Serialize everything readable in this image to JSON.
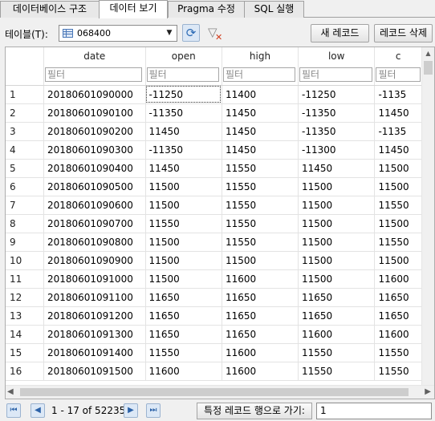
{
  "tabs": [
    {
      "label": "데이터베이스 구조",
      "active": false
    },
    {
      "label": "데이터 보기",
      "active": true
    },
    {
      "label": "Pragma 수정",
      "active": false
    },
    {
      "label": "SQL 실행",
      "active": false
    }
  ],
  "toolbar": {
    "table_label": "테이블(T):",
    "table_value": "068400",
    "new_record_label": "새 레코드",
    "delete_record_label": "레코드 삭제"
  },
  "grid": {
    "columns": [
      "date",
      "open",
      "high",
      "low",
      "c"
    ],
    "filter_placeholder": "필터",
    "rows": [
      [
        "1",
        "20180601090000",
        "-11250",
        "11400",
        "-11250",
        "-1135"
      ],
      [
        "2",
        "20180601090100",
        "-11350",
        "11450",
        "-11350",
        "11450"
      ],
      [
        "3",
        "20180601090200",
        "11450",
        "11450",
        "-11350",
        "-1135"
      ],
      [
        "4",
        "20180601090300",
        "-11350",
        "11450",
        "-11300",
        "11450"
      ],
      [
        "5",
        "20180601090400",
        "11450",
        "11550",
        "11450",
        "11500"
      ],
      [
        "6",
        "20180601090500",
        "11500",
        "11550",
        "11500",
        "11500"
      ],
      [
        "7",
        "20180601090600",
        "11500",
        "11550",
        "11500",
        "11550"
      ],
      [
        "8",
        "20180601090700",
        "11550",
        "11550",
        "11500",
        "11500"
      ],
      [
        "9",
        "20180601090800",
        "11500",
        "11550",
        "11500",
        "11550"
      ],
      [
        "10",
        "20180601090900",
        "11500",
        "11500",
        "11500",
        "11500"
      ],
      [
        "11",
        "20180601091000",
        "11500",
        "11600",
        "11500",
        "11600"
      ],
      [
        "12",
        "20180601091100",
        "11650",
        "11650",
        "11650",
        "11650"
      ],
      [
        "13",
        "20180601091200",
        "11650",
        "11650",
        "11650",
        "11650"
      ],
      [
        "14",
        "20180601091300",
        "11650",
        "11650",
        "11600",
        "11600"
      ],
      [
        "15",
        "20180601091400",
        "11550",
        "11600",
        "11550",
        "11550"
      ],
      [
        "16",
        "20180601091500",
        "11600",
        "11600",
        "11550",
        "11550"
      ]
    ]
  },
  "footer": {
    "page_info": "1 - 17 of 52235",
    "goto_label": "특정 레코드 행으로 가기:",
    "goto_value": "1"
  }
}
